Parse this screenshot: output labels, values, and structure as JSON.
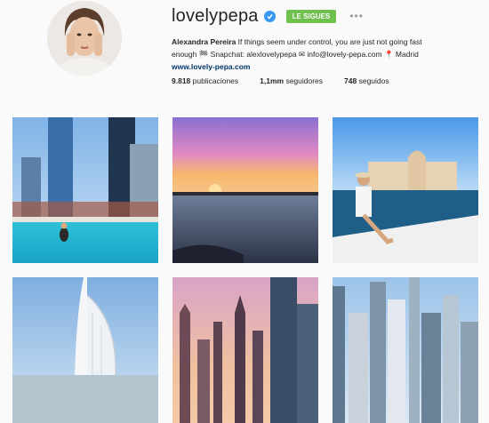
{
  "profile": {
    "username": "lovelypepa",
    "follow_label": "LE SIGUES",
    "more_label": "•••",
    "bio_name": "Alexandra Pereira",
    "bio_line1": " If things seem under control, you are just not going fast",
    "bio_line2": "enough 🏁 Snapchat: alexlovelypepa ✉ info@lovely-pepa.com 📍 Madrid",
    "website": "www.lovely-pepa.com",
    "stats": [
      {
        "value": "9.818",
        "label": " publicaciones"
      },
      {
        "value": "1,1mm",
        "label": " seguidores"
      },
      {
        "value": "748",
        "label": " seguidos"
      }
    ]
  },
  "posts": [
    {
      "subject": "rooftop pool with skyscrapers"
    },
    {
      "subject": "sunset over water"
    },
    {
      "subject": "woman on boat near Atlantis hotel"
    },
    {
      "subject": "Burj Al Arab tower"
    },
    {
      "subject": "city skyline at dusk"
    },
    {
      "subject": "Dubai Marina skyscrapers"
    }
  ],
  "colors": {
    "verified": "#3897f0",
    "follow_button": "#70c050",
    "link": "#003569"
  }
}
